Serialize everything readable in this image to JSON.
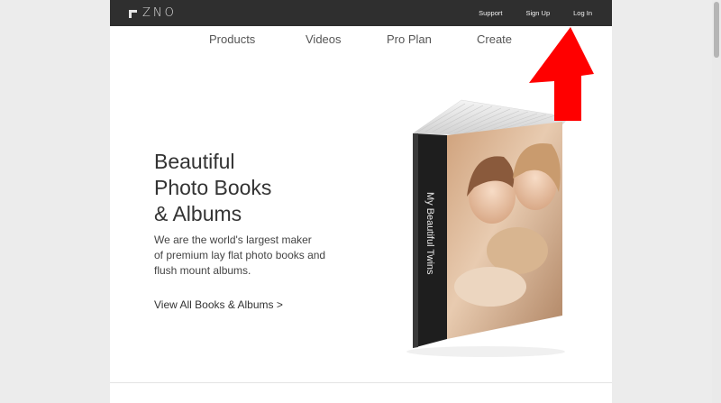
{
  "topbar": {
    "logo_text": "ZNO",
    "links": [
      "Support",
      "Sign Up",
      "Log In"
    ]
  },
  "nav": {
    "items": [
      "Products",
      "Videos",
      "Pro Plan",
      "Create"
    ]
  },
  "hero": {
    "title_lines": [
      "Beautiful",
      "Photo Books",
      "& Albums"
    ],
    "description_lines": [
      "We are the world's largest maker",
      "of premium lay flat photo books and",
      "flush mount albums."
    ],
    "link_text": "View All Books & Albums >",
    "book_spine_text": "My Beautiful Twins"
  },
  "colors": {
    "topbar": "#2f2f2f",
    "arrow": "#ff0000",
    "page_background": "#ececec"
  }
}
